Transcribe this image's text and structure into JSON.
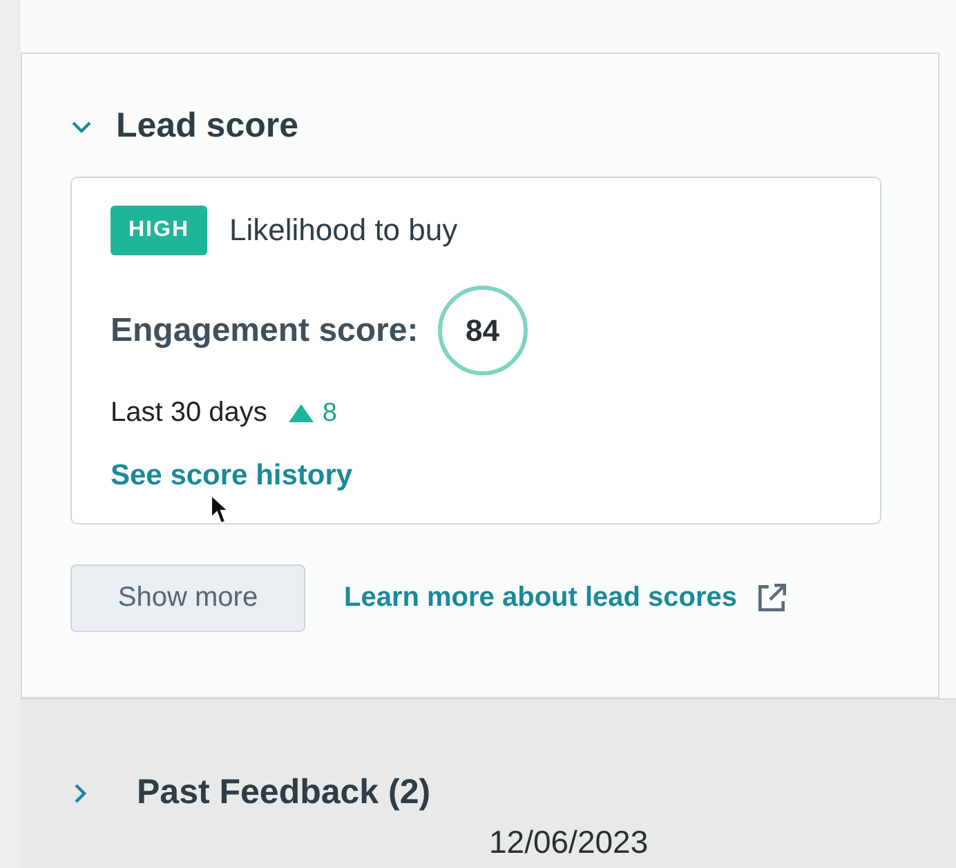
{
  "sections": [
    {
      "kind": "lead_score",
      "title": "Lead score",
      "expanded": true,
      "badge": "HIGH",
      "badge_label": "Likelihood to buy",
      "score_label": "Engagement score:",
      "score": "84",
      "period": "Last 30 days",
      "change": "8",
      "history_link": "See score history",
      "show_more": "Show more",
      "learn_more": "Learn more about lead scores"
    },
    {
      "kind": "feedback",
      "title": "Past Feedback (2)",
      "expanded": false,
      "date": "12/06/2023"
    }
  ]
}
